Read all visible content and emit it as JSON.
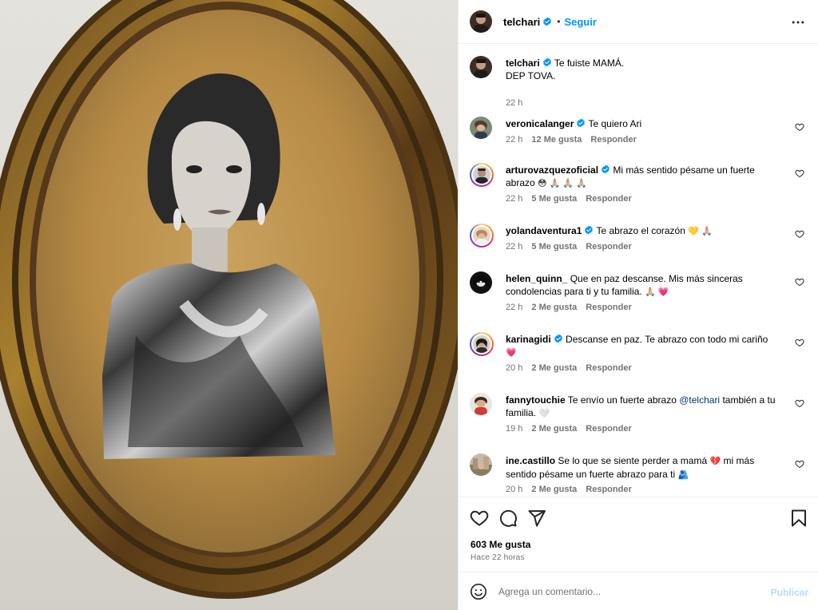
{
  "post": {
    "author": "telchari",
    "follow_label": "Seguir",
    "separator": "•",
    "more_icon": "more-horizontal-icon"
  },
  "caption": {
    "user": "telchari",
    "line1": "Te fuiste MAMÁ.",
    "line2": "DEP TOVA.",
    "time": "22 h"
  },
  "comments": [
    {
      "user": "veronicalanger",
      "verified": true,
      "text": "Te quiero Ari",
      "emojis": "",
      "time": "22 h",
      "likes": "12 Me gusta",
      "reply": "Responder"
    },
    {
      "user": "arturovazquezoficial",
      "verified": true,
      "text": "Mi más sentido pésame un fuerte abrazo",
      "emojis": "😳 🙏🏼 🙏🏼 🙏🏼",
      "time": "22 h",
      "likes": "5 Me gusta",
      "reply": "Responder"
    },
    {
      "user": "yolandaventura1",
      "verified": true,
      "text": "Te abrazo el corazón",
      "emojis": "💛 🙏🏼",
      "time": "22 h",
      "likes": "5 Me gusta",
      "reply": "Responder"
    },
    {
      "user": "helen_quinn_",
      "verified": false,
      "text": "Que en paz descanse. Mis más sinceras condolencias para ti y tu familia.",
      "emojis": "🙏🏼 💗",
      "time": "22 h",
      "likes": "2 Me gusta",
      "reply": "Responder"
    },
    {
      "user": "karinagidi",
      "verified": true,
      "text": "Descanse en paz. Te abrazo con todo mi cariño",
      "emojis": "💗",
      "time": "20 h",
      "likes": "2 Me gusta",
      "reply": "Responder"
    },
    {
      "user": "fannytouchie",
      "verified": false,
      "text_before": "Te envío un fuerte abrazo",
      "mention": "@telchari",
      "text_after": "también a tu familia.",
      "emojis": "🤍",
      "time": "19 h",
      "likes": "2 Me gusta",
      "reply": "Responder"
    },
    {
      "user": "ine.castillo",
      "verified": false,
      "text_before": "Se lo que se siente perder a mamá",
      "emoji_mid": "💔",
      "text_after": "mi más sentido pésame un fuerte abrazo para ti",
      "emojis": "🫂",
      "time": "20 h",
      "likes": "2 Me gusta",
      "reply": "Responder"
    }
  ],
  "actions": {
    "likes": "603 Me gusta",
    "ago": "Hace 22 horas",
    "icons": [
      "heart-icon",
      "comment-icon",
      "share-icon",
      "bookmark-icon"
    ]
  },
  "composer": {
    "placeholder": "Agrega un comentario...",
    "publish_label": "Publicar"
  },
  "colors": {
    "accent": "#0095f6",
    "verified": "#0095f6",
    "muted": "#737373",
    "publish_disabled": "#b3dbff"
  }
}
